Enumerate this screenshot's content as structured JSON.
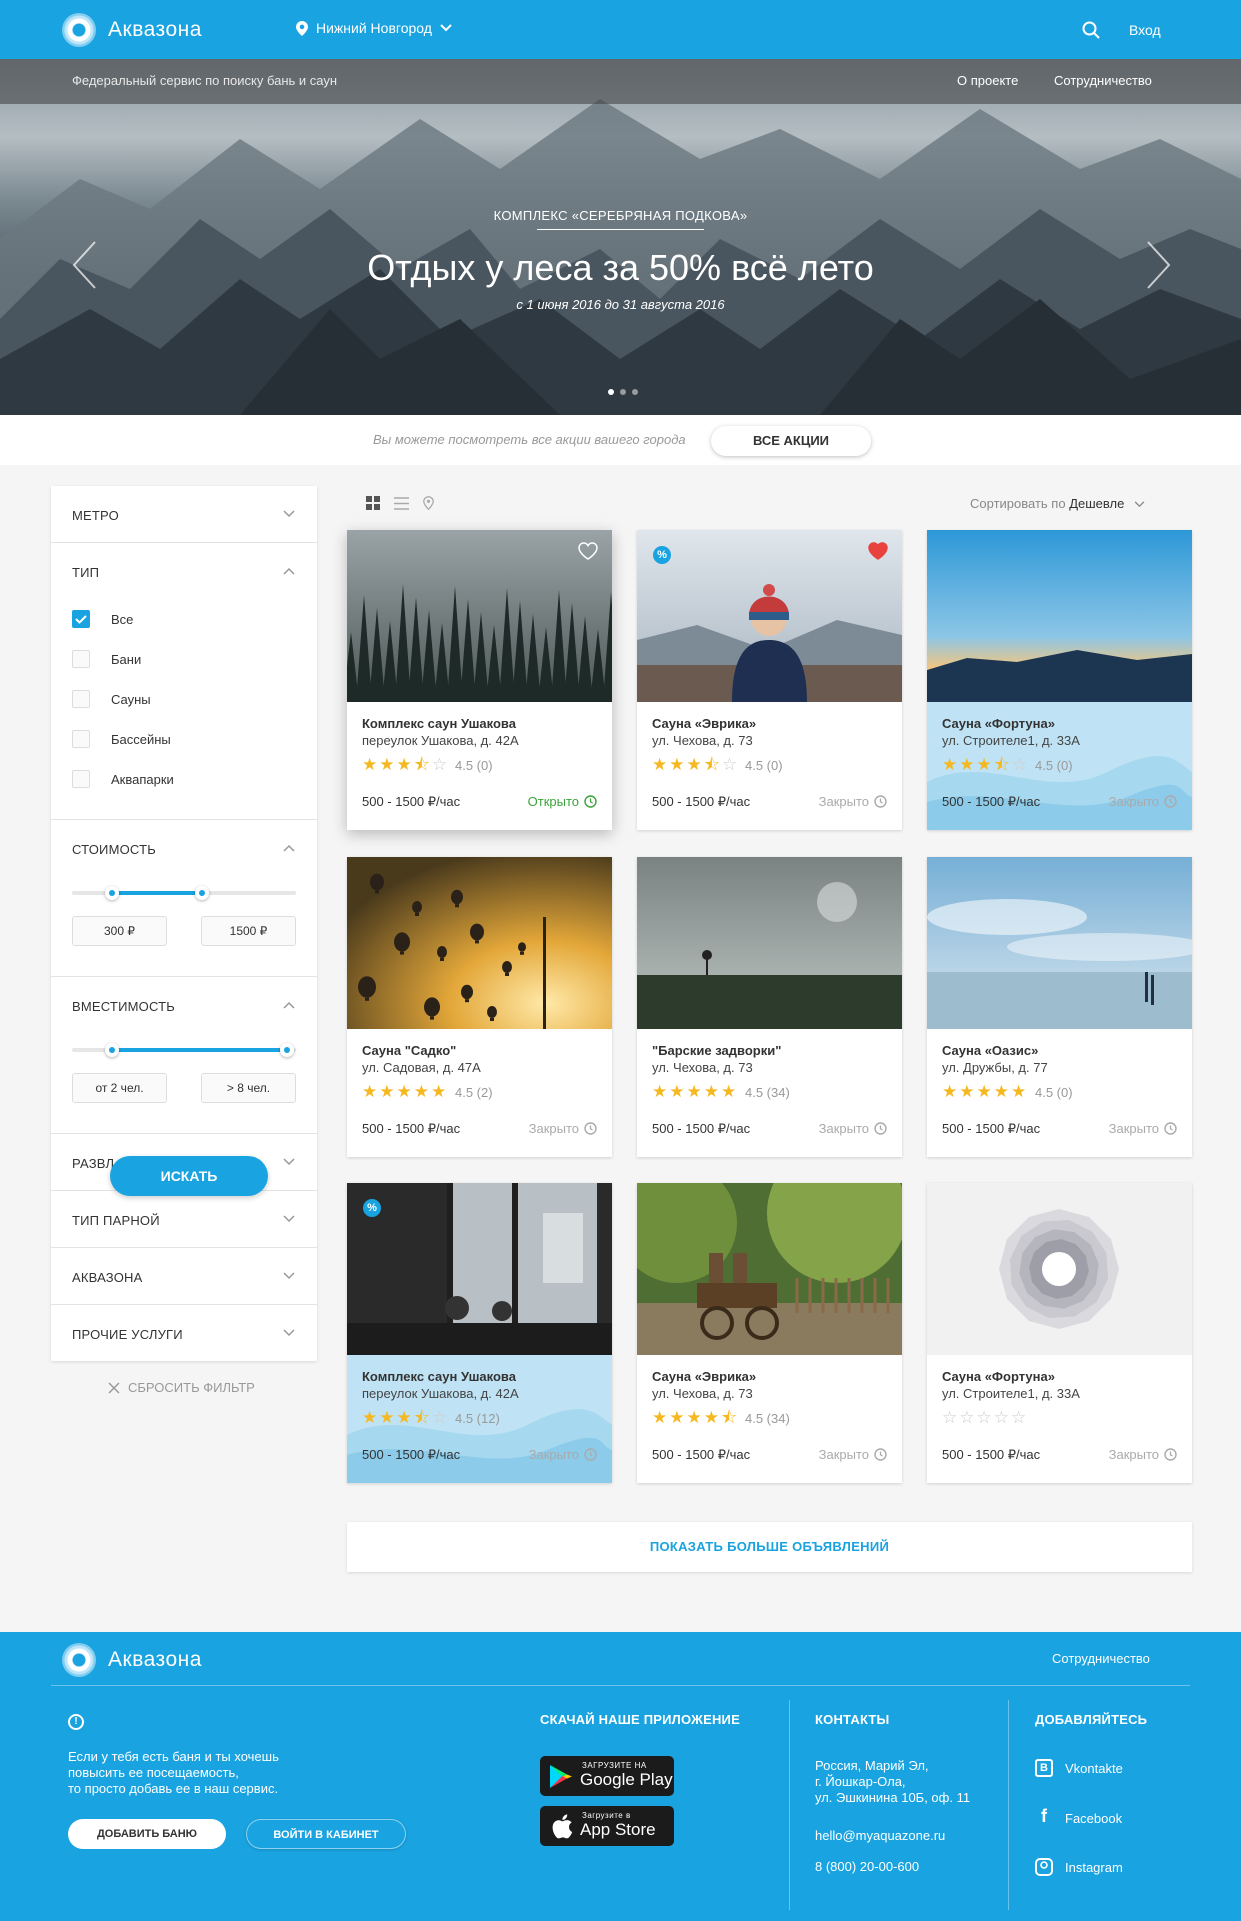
{
  "header": {
    "brand": "Аквазона",
    "city": "Нижний Новгород",
    "login": "Вход"
  },
  "subbar": {
    "tagline": "Федеральный сервис по поиску бань и саун",
    "nav": [
      "О проекте",
      "Сотрудничество"
    ]
  },
  "hero": {
    "kicker": "КОМПЛЕКС «СЕРЕБРЯНАЯ ПОДКОВА»",
    "title": "Отдых у леса за 50% всё лето",
    "dates": "с 1 июня 2016 до 31 августа 2016",
    "slides": 3,
    "active_slide": 1
  },
  "promo": {
    "text": "Вы можете посмотреть все акции вашего города",
    "button": "ВСЕ АКЦИИ"
  },
  "filters": {
    "metro": "МЕТРО",
    "type": {
      "label": "ТИП",
      "options": [
        {
          "label": "Все",
          "checked": true
        },
        {
          "label": "Бани",
          "checked": false
        },
        {
          "label": "Сауны",
          "checked": false
        },
        {
          "label": "Бассейны",
          "checked": false
        },
        {
          "label": "Аквапарки",
          "checked": false
        }
      ]
    },
    "price": {
      "label": "СТОИМОСТЬ",
      "from": "300 ₽",
      "to": "1500 ₽",
      "range": [
        0.18,
        0.58
      ]
    },
    "capacity": {
      "label": "ВМЕСТИМОСТЬ",
      "from": "от 2 чел.",
      "to": "> 8 чел.",
      "range": [
        0.18,
        0.96
      ]
    },
    "entertainment": "РАЗВЛ",
    "steam": "ТИП ПАРНОЙ",
    "aquazone": "АКВАЗОНА",
    "other": "ПРОЧИЕ УСЛУГИ",
    "search": "ИСКАТЬ",
    "reset": "СБРОСИТЬ ФИЛЬТР"
  },
  "sort": {
    "prefix": "Сортировать по",
    "value": "Дешевле"
  },
  "cards": [
    {
      "name": "Комплекс саун Ушакова",
      "address": "переулок Ушакова, д. 42А",
      "stars": 3.5,
      "rating": "4.5 (0)",
      "price": "500 - 1500 ₽/час",
      "status": "Открыто",
      "open": true,
      "heart": "empty"
    },
    {
      "name": "Сауна «Эврика»",
      "address": "ул. Чехова, д. 73",
      "stars": 3.5,
      "rating": "4.5 (0)",
      "price": "500 - 1500 ₽/час",
      "status": "Закрыто",
      "badge": "%",
      "heart": "red"
    },
    {
      "name": "Сауна «Фортуна»",
      "address": "ул. Строителе1, д. 33А",
      "stars": 3.5,
      "rating": "4.5 (0)",
      "price": "500 - 1500 ₽/час",
      "status": "Закрыто",
      "highlight": true
    },
    {
      "name": "Сауна \"Садко\"",
      "address": "ул. Садовая, д. 47А",
      "stars": 5,
      "rating": "4.5 (2)",
      "price": "500 - 1500 ₽/час",
      "status": "Закрыто"
    },
    {
      "name": "\"Барские задворки\"",
      "address": "ул. Чехова, д. 73",
      "stars": 5,
      "rating": "4.5 (34)",
      "price": "500 - 1500 ₽/час",
      "status": "Закрыто"
    },
    {
      "name": "Сауна «Оазис»",
      "address": "ул. Дружбы, д. 77",
      "stars": 5,
      "rating": "4.5 (0)",
      "price": "500 - 1500 ₽/час",
      "status": "Закрыто"
    },
    {
      "name": "Комплекс саун Ушакова",
      "address": "переулок Ушакова, д. 42А",
      "stars": 3.5,
      "rating": "4.5 (12)",
      "price": "500 - 1500 ₽/час",
      "status": "Закрыто",
      "badge": "%",
      "highlight": true
    },
    {
      "name": "Сауна «Эврика»",
      "address": "ул. Чехова, д. 73",
      "stars": 4.5,
      "rating": "4.5 (34)",
      "price": "500 - 1500 ₽/час",
      "status": "Закрыто"
    },
    {
      "name": "Сауна «Фортуна»",
      "address": "ул. Строителе1, д. 33А",
      "stars": 0,
      "rating": "",
      "price": "500 - 1500 ₽/час",
      "status": "Закрыто"
    }
  ],
  "more": "ПОКАЗАТЬ БОЛЬШЕ ОБЪЯВЛЕНИЙ",
  "footer": {
    "brand": "Аквазона",
    "coop": "Сотрудничество",
    "text": "Если у тебя есть баня и ты хочешь\nповысить ее посещаемость,\nто просто добавь ее в наш сервис.",
    "btn_add": "ДОБАВИТЬ БАНЮ",
    "btn_login": "ВОЙТИ В КАБИНЕТ",
    "app_title": "СКАЧАЙ НАШЕ ПРИЛОЖЕНИЕ",
    "gp_small": "ЗАГРУЗИТЕ НА",
    "gp_big": "Google Play",
    "as_small": "Загрузите в",
    "as_big": "App Store",
    "contacts_title": "КОНТАКТЫ",
    "address": "Россия, Марий Эл,\nг. Йошкар-Ола,\nул. Эшкинина 10Б, оф. 11",
    "email": "hello@myaquazone.ru",
    "phone": "8 (800) 20-00-600",
    "social_title": "ДОБАВЛЯЙТЕСЬ",
    "social": [
      "Vkontakte",
      "Facebook",
      "Instagram"
    ]
  },
  "colors": {
    "accent": "#19a3e0",
    "open": "#3aa33a",
    "star": "#f5b821",
    "heart": "#e8413e"
  }
}
